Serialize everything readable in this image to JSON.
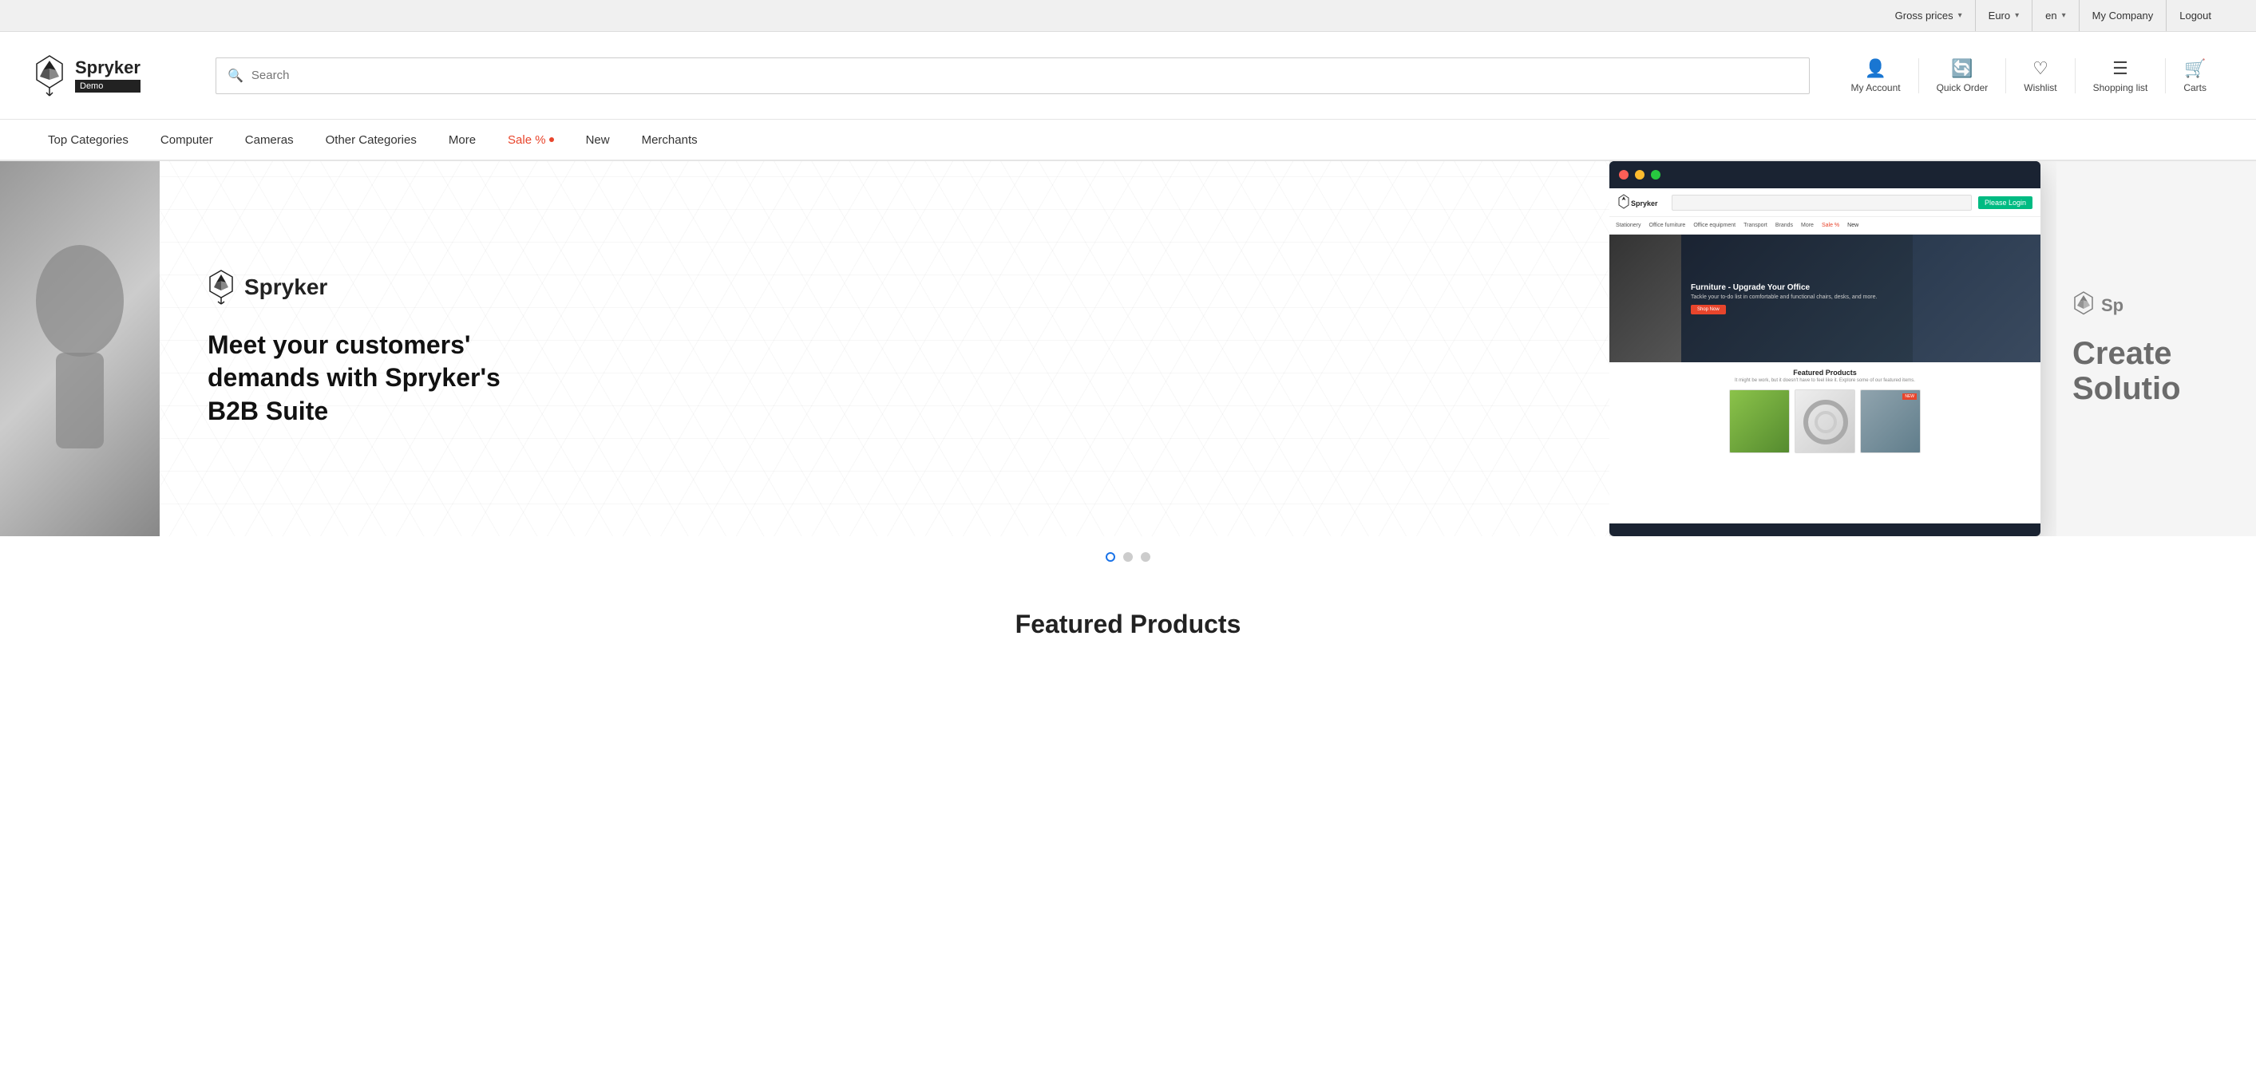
{
  "topbar": {
    "gross_prices_label": "Gross prices",
    "euro_label": "Euro",
    "lang_label": "en",
    "company_label": "My Company",
    "logout_label": "Logout"
  },
  "header": {
    "brand": "Spryker",
    "demo_badge": "Demo",
    "search_placeholder": "Search",
    "actions": [
      {
        "id": "my-account",
        "icon": "person",
        "label": "My Account"
      },
      {
        "id": "quick-order",
        "icon": "refresh-cw",
        "label": "Quick Order"
      },
      {
        "id": "wishlist",
        "icon": "heart",
        "label": "Wishlist"
      },
      {
        "id": "shopping-list",
        "icon": "list",
        "label": "Shopping list"
      },
      {
        "id": "carts",
        "icon": "cart",
        "label": "Carts"
      }
    ]
  },
  "nav": {
    "items": [
      {
        "id": "top-categories",
        "label": "Top Categories",
        "style": "normal"
      },
      {
        "id": "computer",
        "label": "Computer",
        "style": "normal"
      },
      {
        "id": "cameras",
        "label": "Cameras",
        "style": "normal"
      },
      {
        "id": "other-categories",
        "label": "Other Categories",
        "style": "normal"
      },
      {
        "id": "more",
        "label": "More",
        "style": "normal"
      },
      {
        "id": "sale",
        "label": "Sale %",
        "style": "sale"
      },
      {
        "id": "new",
        "label": "New",
        "style": "normal"
      },
      {
        "id": "merchants",
        "label": "Merchants",
        "style": "normal"
      }
    ]
  },
  "hero": {
    "slide1": {
      "brand": "Spryker",
      "headline": "Meet your customers' demands with Spryker's B2B Suite",
      "screenshot": {
        "nav_items": [
          "Stationery",
          "Office furniture",
          "Office equipment",
          "Transport",
          "Brands",
          "More",
          "Sale %",
          "New"
        ],
        "hero_title": "Furniture - Upgrade Your Office",
        "hero_subtitle": "Tackle your to-do list in comfortable and functional chairs, desks, and more.",
        "hero_btn": "Shop Now",
        "featured_title": "Featured Products",
        "featured_subtitle": "It might be work, but it doesn't have to feel like it. Explore some of our featured items."
      }
    },
    "slide2_partial": {
      "text_line1": "Create",
      "text_line2": "Solutio"
    }
  },
  "slider": {
    "dots": [
      {
        "state": "active"
      },
      {
        "state": "inactive"
      },
      {
        "state": "inactive"
      }
    ]
  },
  "featured": {
    "title": "Featured Products"
  }
}
